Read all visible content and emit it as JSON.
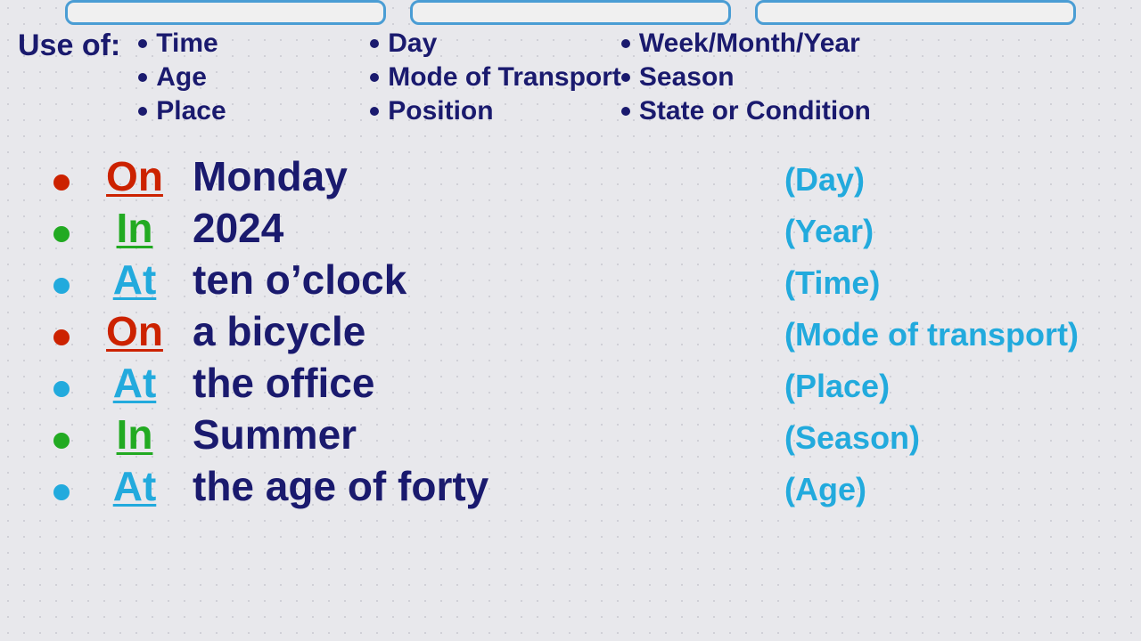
{
  "topButtons": [
    {
      "label": ""
    },
    {
      "label": ""
    },
    {
      "label": ""
    }
  ],
  "useOf": {
    "label": "Use of:",
    "col1": [
      {
        "text": "Time"
      },
      {
        "text": "Age"
      },
      {
        "text": "Place"
      }
    ],
    "col2": [
      {
        "text": "Day"
      },
      {
        "text": "Mode of Transport"
      },
      {
        "text": "Position"
      }
    ],
    "col3": [
      {
        "text": "Week/Month/Year"
      },
      {
        "text": "Season"
      },
      {
        "text": "State or Condition"
      }
    ]
  },
  "examples": [
    {
      "preposition": "On",
      "color": "red",
      "bulletColor": "bullet-red",
      "phrase": "Monday",
      "label": "(Day)"
    },
    {
      "preposition": "In",
      "color": "green",
      "bulletColor": "bullet-green",
      "phrase": "2024",
      "label": "(Year)"
    },
    {
      "preposition": "At",
      "color": "cyan",
      "bulletColor": "bullet-cyan",
      "phrase": "ten o’clock",
      "label": "(Time)"
    },
    {
      "preposition": "On",
      "color": "red",
      "bulletColor": "bullet-red",
      "phrase": "a bicycle",
      "label": "(Mode of transport)"
    },
    {
      "preposition": "At",
      "color": "cyan",
      "bulletColor": "bullet-cyan",
      "phrase": "the office",
      "label": "(Place)"
    },
    {
      "preposition": "In",
      "color": "green",
      "bulletColor": "bullet-green",
      "phrase": "Summer",
      "label": "(Season)"
    },
    {
      "preposition": "At",
      "color": "cyan",
      "bulletColor": "bullet-cyan",
      "phrase": "the age of forty",
      "label": "(Age)"
    }
  ]
}
